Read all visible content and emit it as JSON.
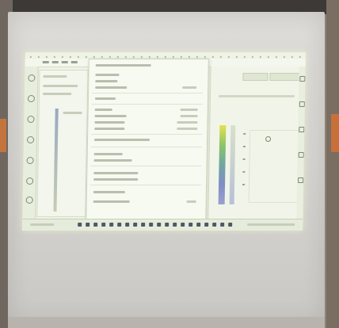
{
  "scene": {
    "description_free": true
  },
  "colors": {
    "screen": "#d6d4d0",
    "projection": "#eef3e4",
    "wall": "#8e8275",
    "accent_orange": "#c4753e"
  },
  "icons": {
    "left_toolbar": [
      "tool-icon",
      "tool-icon",
      "tool-icon",
      "tool-icon",
      "tool-icon",
      "tool-icon",
      "tool-icon",
      "tool-icon"
    ],
    "status": [
      "status-icon"
    ]
  }
}
